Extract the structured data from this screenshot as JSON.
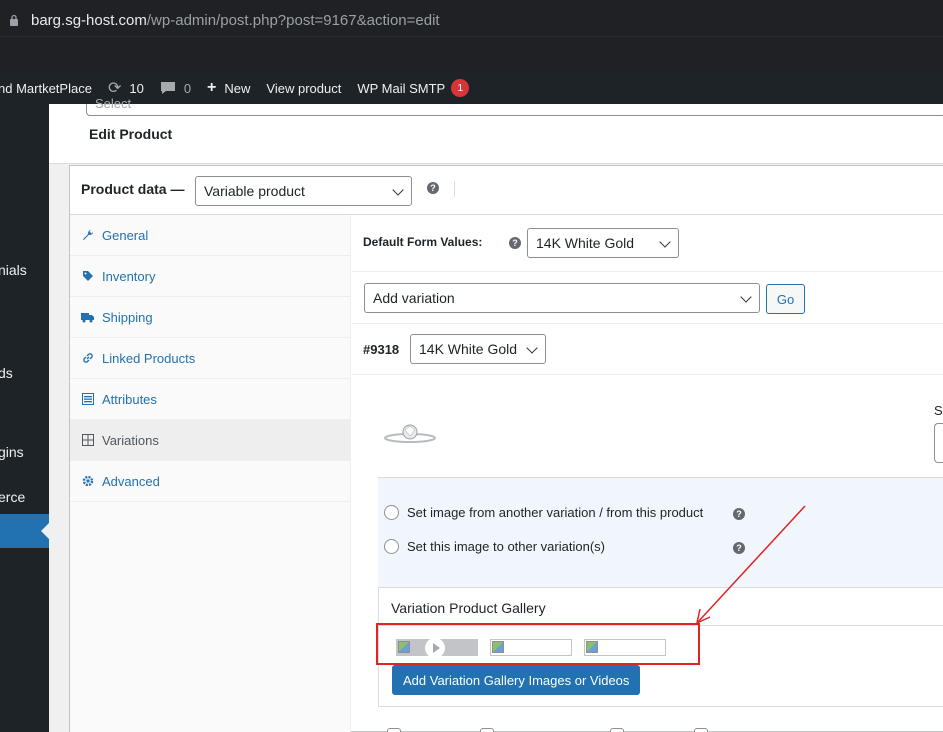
{
  "browser": {
    "url_host": "barg.sg-host.com",
    "url_path": "/wp-admin/post.php?post=9167&action=edit"
  },
  "adminbar": {
    "site_name": "nd MartketPlace",
    "updates_count": "10",
    "comments_count": "0",
    "new_label": "New",
    "view_product_label": "View product",
    "mail_smtp_label": "WP Mail SMTP",
    "mail_smtp_badge": "1"
  },
  "adminmenu": {
    "fragments": [
      "nials",
      "ds",
      "gins",
      "erce"
    ]
  },
  "page": {
    "select_placeholder": "Select",
    "title": "Edit Product"
  },
  "product_data": {
    "label": "Product data —",
    "type_selected": "Variable product",
    "tabs": [
      {
        "label": "General",
        "icon": "wrench-icon"
      },
      {
        "label": "Inventory",
        "icon": "tag-icon"
      },
      {
        "label": "Shipping",
        "icon": "truck-icon"
      },
      {
        "label": "Linked Products",
        "icon": "link-icon"
      },
      {
        "label": "Attributes",
        "icon": "list-icon"
      },
      {
        "label": "Variations",
        "icon": "grid-icon"
      },
      {
        "label": "Advanced",
        "icon": "gear-icon"
      }
    ],
    "active_tab": "Variations"
  },
  "variations": {
    "default_form_values_label": "Default Form Values:",
    "default_value": "14K White Gold",
    "add_variation_selected": "Add variation",
    "go_label": "Go",
    "variation_id": "#9318",
    "variation_value": "14K White Gold",
    "sku_fragment": "SI",
    "option_from_variation": "Set image from another variation / from this product",
    "option_to_other": "Set this image to other variation(s)",
    "gallery_title": "Variation Product Gallery",
    "gallery_button": "Add Variation Gallery Images or Videos"
  },
  "annotation": {
    "highlight_color": "#e02424"
  }
}
